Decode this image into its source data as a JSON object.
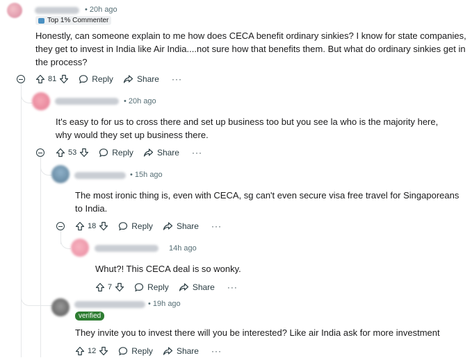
{
  "comments": [
    {
      "time": "• 20h ago",
      "flair": "Top 1% Commenter",
      "text": "Honestly, can someone explain to me how does CECA benefit ordinary sinkies? I know for state companies, they get to invest in India like Air India....not sure how that benefits them. But what do ordinary sinkies get in the process?",
      "votes": "81"
    },
    {
      "time": "• 20h ago",
      "text": "It's easy to for us to cross there and set up business too but you see la who is the majority here, why would they set up business there.",
      "votes": "53"
    },
    {
      "time": "• 15h ago",
      "text": "The most ironic thing is, even with CECA, sg can't even secure visa free travel for Singaporeans to India.",
      "votes": "18"
    },
    {
      "time": "14h ago",
      "text": "Whut?! This CECA deal is so wonky.",
      "votes": "7"
    },
    {
      "time": "• 19h ago",
      "flair": "verified",
      "text": "They invite you to invest there will you be interested? Like air India ask for more investment",
      "votes": "12"
    }
  ],
  "actions": {
    "reply": "Reply",
    "share": "Share",
    "more": "···"
  },
  "colors": {
    "text": "#1a1a1b",
    "meta": "#576f76",
    "thread_line": "#e5e7e9",
    "verified_bg": "#2e7d32"
  }
}
